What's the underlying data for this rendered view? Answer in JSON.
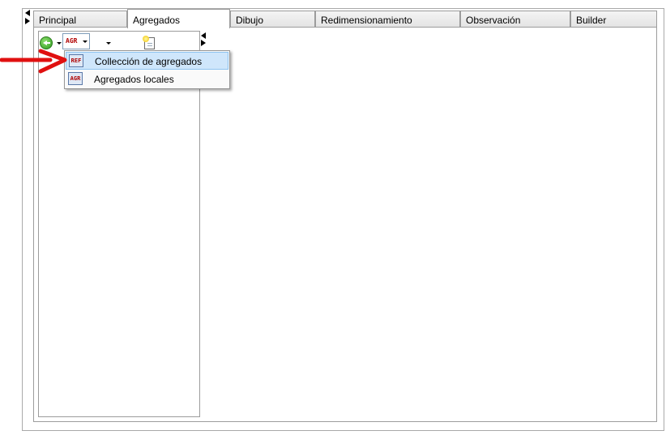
{
  "tabs": [
    {
      "label": "Principal"
    },
    {
      "label": "Agregados"
    },
    {
      "label": "Dibujo"
    },
    {
      "label": "Redimensionamiento"
    },
    {
      "label": "Observación"
    },
    {
      "label": "Builder"
    }
  ],
  "active_tab": "Agregados",
  "toolbar": {
    "agr_icon_text": "AGR"
  },
  "dropdown_menu": {
    "items": [
      {
        "label": "Collección de agregados",
        "icon_text": "REF",
        "highlighted": true
      },
      {
        "label": "Agregados locales",
        "icon_text": "AGR",
        "highlighted": false
      }
    ]
  },
  "annotation": {
    "color": "#e01010"
  }
}
